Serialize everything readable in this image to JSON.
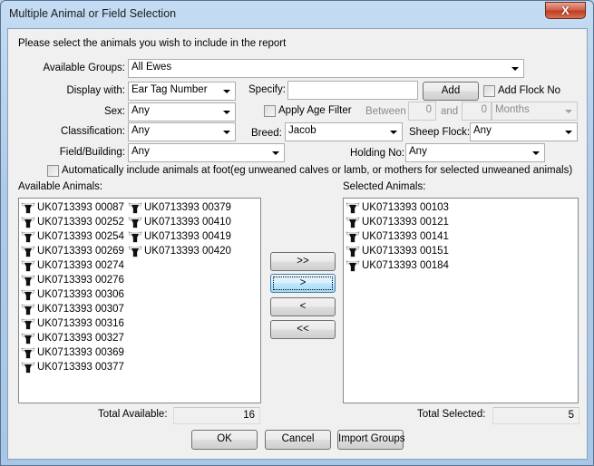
{
  "window": {
    "title": "Multiple Animal or Field Selection",
    "close_label": "X"
  },
  "intro_text": "Please select the animals you wish to include in the report",
  "filters": {
    "available_groups": {
      "label": "Available Groups:",
      "value": "All Ewes"
    },
    "display_with": {
      "label": "Display with:",
      "value": "Ear Tag Number"
    },
    "specify": {
      "label": "Specify:",
      "value": ""
    },
    "add_button": "Add",
    "add_flock_no": {
      "label": "Add Flock No",
      "checked": false
    },
    "sex": {
      "label": "Sex:",
      "value": "Any"
    },
    "apply_age_filter": {
      "label": "Apply Age Filter",
      "checked": false
    },
    "between": {
      "label": "Between",
      "from": "0",
      "and_label": "and",
      "to": "0",
      "unit": "Months"
    },
    "classification": {
      "label": "Classification:",
      "value": "Any"
    },
    "breed": {
      "label": "Breed:",
      "value": "Jacob"
    },
    "sheep_flock": {
      "label": "Sheep Flock:",
      "value": "Any"
    },
    "field_building": {
      "label": "Field/Building:",
      "value": "Any"
    },
    "holding_no": {
      "label": "Holding No:",
      "value": "Any"
    },
    "auto_include": {
      "label": "Automatically include animals at foot(eg unweaned calves or lamb, or mothers for selected unweaned animals)",
      "checked": false
    }
  },
  "available": {
    "label": "Available Animals:",
    "items": [
      "UK0713393 00087",
      "UK0713393 00252",
      "UK0713393 00254",
      "UK0713393 00269",
      "UK0713393 00274",
      "UK0713393 00276",
      "UK0713393 00306",
      "UK0713393 00307",
      "UK0713393 00316",
      "UK0713393 00327",
      "UK0713393 00369",
      "UK0713393 00377",
      "UK0713393 00379",
      "UK0713393 00410",
      "UK0713393 00419",
      "UK0713393 00420"
    ],
    "total_label": "Total Available:",
    "total": "16"
  },
  "selected": {
    "label": "Selected Animals:",
    "items": [
      "UK0713393 00103",
      "UK0713393 00121",
      "UK0713393 00141",
      "UK0713393 00151",
      "UK0713393 00184"
    ],
    "total_label": "Total Selected:",
    "total": "5"
  },
  "transfer_buttons": {
    "add_all": ">>",
    "add_one": ">",
    "remove_one": "<",
    "remove_all": "<<"
  },
  "footer": {
    "ok": "OK",
    "cancel": "Cancel",
    "import_groups": "Import Groups"
  }
}
